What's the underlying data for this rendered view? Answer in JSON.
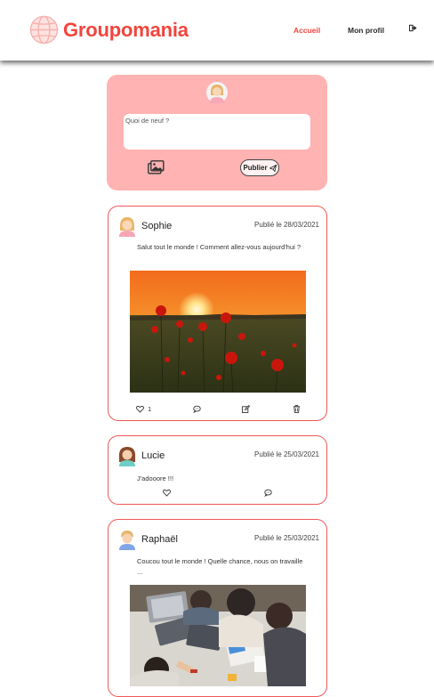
{
  "header": {
    "logo_text": "Groupomania",
    "nav": {
      "home": "Accueil",
      "profile": "Mon profil",
      "logout_icon": "sign-out-icon"
    }
  },
  "composer": {
    "placeholder": "Quoi de neuf ?",
    "image_icon": "images-icon",
    "publish_label": "Publier",
    "publish_icon": "paper-plane-icon"
  },
  "posts": [
    {
      "author": "Sophie",
      "date": "Publié le 28/03/2021",
      "text": "Salut tout le monde ! Comment allez-vous aujourd'hui ?",
      "image": "poppy-field-sunset-photo",
      "likes": "1",
      "actions": [
        "like-icon",
        "comment-icon",
        "edit-icon",
        "delete-icon"
      ]
    },
    {
      "author": "Lucie",
      "date": "Publié le 25/03/2021",
      "text": "J'adooore !!!",
      "likes": "",
      "actions": [
        "like-icon",
        "comment-icon"
      ]
    },
    {
      "author": "Raphaël",
      "date": "Publié le 25/03/2021",
      "text": "Coucou tout le monde ! Quelle chance, nous on travaille ...",
      "image": "team-working-at-table-photo"
    }
  ],
  "colors": {
    "brand": "#f2453d",
    "composer_bg": "#ffb3b3",
    "post_border": "#f0595a"
  }
}
